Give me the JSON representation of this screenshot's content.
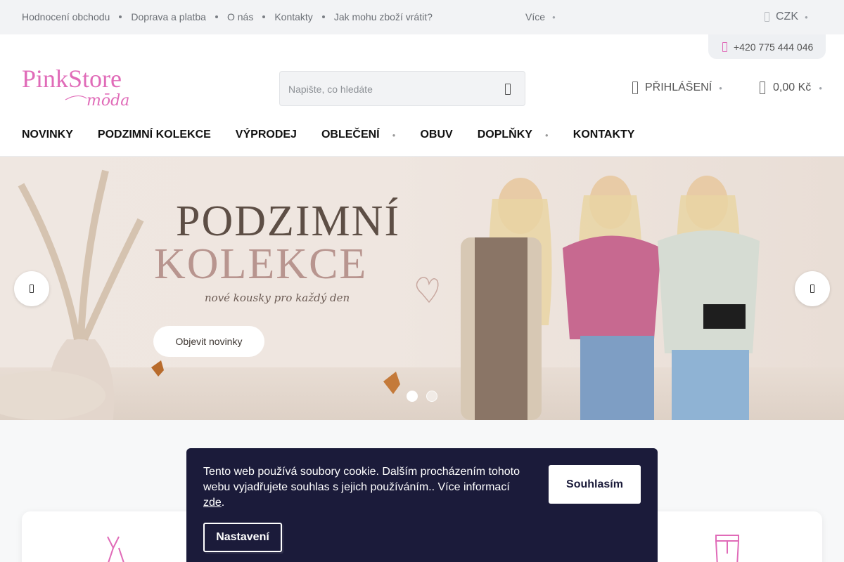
{
  "colors": {
    "brand_pink": "#e06bb8",
    "cookie_bg": "#1b1b3a",
    "topbar_bg": "#f2f3f5"
  },
  "topbar": {
    "links": [
      "Hodnocení obchodu",
      "Doprava a platba",
      "O nás",
      "Kontakty",
      "Jak mohu zboží vrátit?"
    ],
    "more_label": "Více",
    "currency": "CZK",
    "phone": "+420 775 444 046"
  },
  "logo": {
    "text_main": "PinkStore",
    "text_sub": "mōda"
  },
  "search": {
    "placeholder": "Napište, co hledáte",
    "icon": "search-icon"
  },
  "account": {
    "login_label": "PŘIHLÁŠENÍ",
    "cart_total": "0,00 Kč"
  },
  "nav": [
    {
      "label": "NOVINKY",
      "has_dropdown": false
    },
    {
      "label": "PODZIMNÍ KOLEKCE",
      "has_dropdown": false
    },
    {
      "label": "VÝPRODEJ",
      "has_dropdown": false
    },
    {
      "label": "OBLEČENÍ",
      "has_dropdown": true
    },
    {
      "label": "OBUV",
      "has_dropdown": false
    },
    {
      "label": "DOPLŇKY",
      "has_dropdown": true
    },
    {
      "label": "KONTAKTY",
      "has_dropdown": false
    }
  ],
  "hero": {
    "title_line1": "PODZIMNÍ",
    "title_line2": "KOLEKCE",
    "subtitle": "nové kousky pro každý den",
    "cta_label": "Objevit novinky",
    "slides": 2,
    "active_slide": 1
  },
  "cookie": {
    "text": "Tento web používá soubory cookie. Dalším procházením tohoto webu vyjadřujete souhlas s jejich používáním.. Více informací",
    "link_text": "zde",
    "trailing": ".",
    "agree_label": "Souhlasím",
    "settings_label": "Nastavení"
  }
}
